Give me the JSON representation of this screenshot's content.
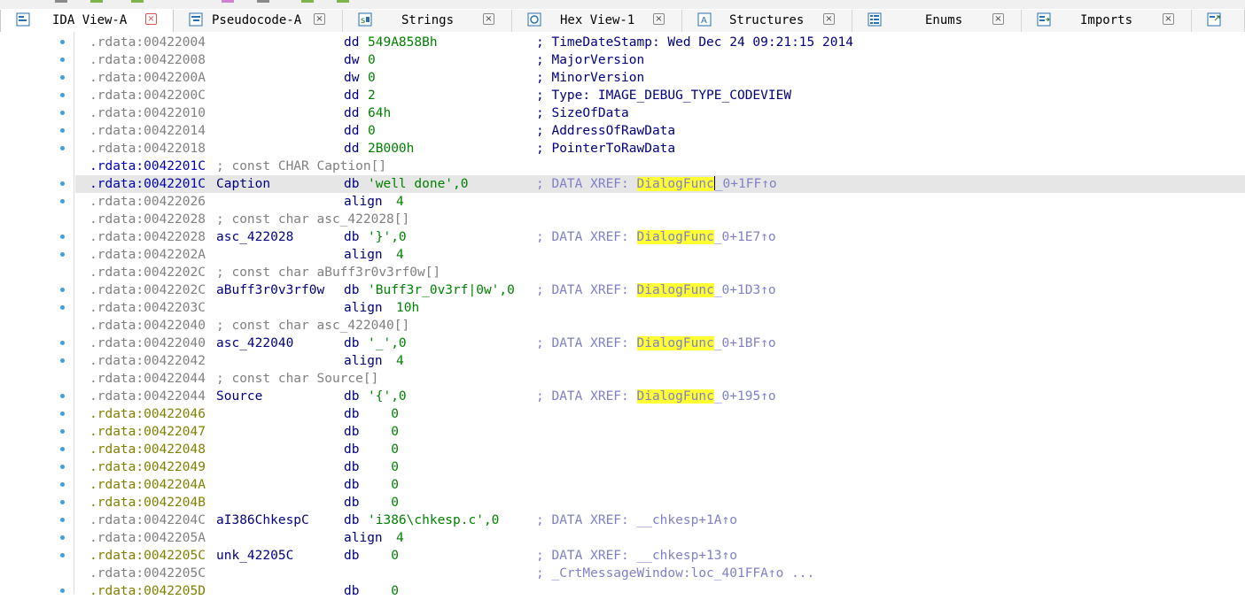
{
  "tabs": [
    {
      "label": "IDA View-A",
      "icon": "disassembly-icon",
      "active": true
    },
    {
      "label": "Pseudocode-A",
      "icon": "pseudocode-icon"
    },
    {
      "label": "Strings",
      "icon": "strings-icon"
    },
    {
      "label": "Hex View-1",
      "icon": "hex-icon"
    },
    {
      "label": "Structures",
      "icon": "structures-icon"
    },
    {
      "label": "Enums",
      "icon": "enums-icon"
    },
    {
      "label": "Imports",
      "icon": "imports-icon"
    },
    {
      "label": "",
      "icon": "exports-icon"
    }
  ],
  "close_glyph": "×",
  "colors": {
    "highlight": "#ffff33",
    "address": "#808080",
    "unexplored": "#808000",
    "operand": "#008000",
    "comment": "#000080",
    "xref": "#8080c8",
    "marker": "#3aa0e0"
  },
  "lines": [
    {
      "addr": ".rdata:00422004",
      "ins": "dd",
      "opnd": "549A858Bh",
      "cmt": "; TimeDateStamp: Wed Dec 24 09:21:15 2014",
      "dot": true
    },
    {
      "addr": ".rdata:00422008",
      "ins": "dw",
      "opnd": "0",
      "cmt": "; MajorVersion",
      "dot": true
    },
    {
      "addr": ".rdata:0042200A",
      "ins": "dw",
      "opnd": "0",
      "cmt": "; MinorVersion",
      "dot": true
    },
    {
      "addr": ".rdata:0042200C",
      "ins": "dd",
      "opnd": "2",
      "cmt": "; Type: IMAGE_DEBUG_TYPE_CODEVIEW",
      "dot": true
    },
    {
      "addr": ".rdata:00422010",
      "ins": "dd",
      "opnd": "64h",
      "cmt": "; SizeOfData",
      "dot": true
    },
    {
      "addr": ".rdata:00422014",
      "ins": "dd",
      "opnd": "0",
      "cmt": "; AddressOfRawData",
      "dot": true
    },
    {
      "addr": ".rdata:00422018",
      "ins": "dd",
      "opnd": "2B000h",
      "cmt": "; PointerToRawData",
      "dot": true
    },
    {
      "addr": ".rdata:0042201C",
      "addr_style": "blue",
      "bcmt": "; const CHAR Caption[]"
    },
    {
      "addr": ".rdata:0042201C",
      "addr_style": "blue",
      "name": "Caption",
      "ins": "db",
      "opnd": "'well done',0",
      "xref_pre": "; DATA XREF: ",
      "xref_hl": "DialogFunc",
      "xref_post": "_0+1FF↑o",
      "dot": true,
      "current": true,
      "cursor": true
    },
    {
      "addr": ".rdata:00422026",
      "ins": "align",
      "opnd": "4",
      "dot": true
    },
    {
      "addr": ".rdata:00422028",
      "bcmt": "; const char asc_422028[]"
    },
    {
      "addr": ".rdata:00422028",
      "name": "asc_422028",
      "ins": "db",
      "opnd": "'}',0",
      "xref_pre": "; DATA XREF: ",
      "xref_hl": "DialogFunc",
      "xref_post": "_0+1E7↑o",
      "dot": true
    },
    {
      "addr": ".rdata:0042202A",
      "ins": "align",
      "opnd": "4",
      "dot": true
    },
    {
      "addr": ".rdata:0042202C",
      "bcmt": "; const char aBuff3r0v3rf0w[]"
    },
    {
      "addr": ".rdata:0042202C",
      "name": "aBuff3r0v3rf0w",
      "ins": "db",
      "opnd": "'Buff3r_0v3rf|0w',0",
      "xref_pre": "; DATA XREF: ",
      "xref_hl": "DialogFunc",
      "xref_post": "_0+1D3↑o",
      "dot": true
    },
    {
      "addr": ".rdata:0042203C",
      "ins": "align",
      "opnd": "10h",
      "dot": true
    },
    {
      "addr": ".rdata:00422040",
      "bcmt": "; const char asc_422040[]"
    },
    {
      "addr": ".rdata:00422040",
      "name": "asc_422040",
      "ins": "db",
      "opnd": "'_',0",
      "xref_pre": "; DATA XREF: ",
      "xref_hl": "DialogFunc",
      "xref_post": "_0+1BF↑o",
      "dot": true
    },
    {
      "addr": ".rdata:00422042",
      "ins": "align",
      "opnd": "4",
      "dot": true
    },
    {
      "addr": ".rdata:00422044",
      "bcmt": "; const char Source[]"
    },
    {
      "addr": ".rdata:00422044",
      "name": "Source",
      "ins": "db",
      "opnd": "'{',0",
      "xref_pre": "; DATA XREF: ",
      "xref_hl": "DialogFunc",
      "xref_post": "_0+195↑o",
      "dot": true
    },
    {
      "addr": ".rdata:00422046",
      "addr_style": "unexp",
      "ins": "db",
      "opnd": "   0",
      "dot": true
    },
    {
      "addr": ".rdata:00422047",
      "addr_style": "unexp",
      "ins": "db",
      "opnd": "   0",
      "dot": true
    },
    {
      "addr": ".rdata:00422048",
      "addr_style": "unexp",
      "ins": "db",
      "opnd": "   0",
      "dot": true
    },
    {
      "addr": ".rdata:00422049",
      "addr_style": "unexp",
      "ins": "db",
      "opnd": "   0",
      "dot": true
    },
    {
      "addr": ".rdata:0042204A",
      "addr_style": "unexp",
      "ins": "db",
      "opnd": "   0",
      "dot": true
    },
    {
      "addr": ".rdata:0042204B",
      "addr_style": "unexp",
      "ins": "db",
      "opnd": "   0",
      "dot": true
    },
    {
      "addr": ".rdata:0042204C",
      "name": "aI386ChkespC",
      "ins": "db",
      "opnd": "'i386\\chkesp.c',0",
      "xref_pre": "; DATA XREF: __chkesp+1A↑o",
      "dot": true
    },
    {
      "addr": ".rdata:0042205A",
      "ins": "align",
      "opnd": "4",
      "dot": true
    },
    {
      "addr": ".rdata:0042205C",
      "addr_style": "unexp",
      "name": "unk_42205C",
      "ins": "db",
      "opnd": "   0",
      "xref_pre": "; DATA XREF: __chkesp+13↑o",
      "dot": true
    },
    {
      "addr": ".rdata:0042205C",
      "xref_pre": "; _CrtMessageWindow:loc_401FFA↑o ..."
    },
    {
      "addr": ".rdata:0042205D",
      "addr_style": "unexp",
      "ins": "db",
      "opnd": "   0",
      "dot": true
    }
  ]
}
